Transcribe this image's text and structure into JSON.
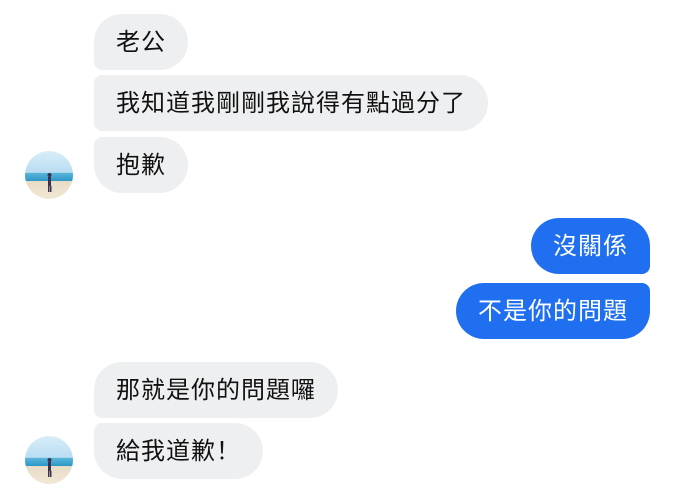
{
  "messages": [
    {
      "id": "b0",
      "direction": "incoming",
      "text": "老公"
    },
    {
      "id": "b1",
      "direction": "incoming",
      "text": "我知道我剛剛我說得有點過分了"
    },
    {
      "id": "b2",
      "direction": "incoming",
      "text": "抱歉"
    },
    {
      "id": "b3",
      "direction": "outgoing",
      "text": "沒關係"
    },
    {
      "id": "b4",
      "direction": "outgoing",
      "text": "不是你的問題"
    },
    {
      "id": "b5",
      "direction": "incoming",
      "text": "那就是你的問題囉"
    },
    {
      "id": "b6",
      "direction": "incoming",
      "text": "給我道歉！"
    }
  ],
  "colors": {
    "incoming_bubble": "#eeeff1",
    "incoming_text": "#111111",
    "outgoing_bubble": "#1f6ff0",
    "outgoing_text": "#ffffff",
    "background": "#ffffff"
  },
  "avatar": {
    "icon": "beach-photo-avatar"
  }
}
